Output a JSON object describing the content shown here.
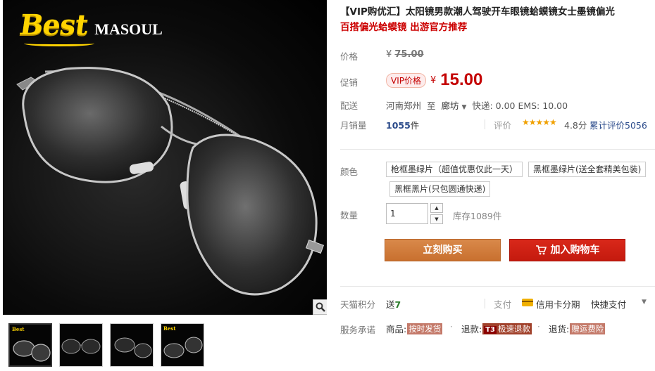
{
  "brand": {
    "best": "Best",
    "masoul": "MASOUL"
  },
  "product": {
    "title": "【VIP购优汇】太阳镜男款潮人驾驶开车眼镜蛤蟆镜女士墨镜偏光",
    "subtitle": "百搭偏光蛤蟆镜 出游官方推荐"
  },
  "price": {
    "label": "价格",
    "currency": "¥",
    "original": "75.00"
  },
  "promo": {
    "label": "促销",
    "tag": "VIP价格",
    "currency": "¥",
    "price": "15.00"
  },
  "shipping": {
    "label": "配送",
    "origin": "河南郑州",
    "to": "至",
    "dest": "廊坊",
    "info": "快递: 0.00 EMS: 10.00"
  },
  "sales": {
    "label": "月销量",
    "count": "1055",
    "unit": "件"
  },
  "rating": {
    "label": "评价",
    "stars": "★★★★★",
    "score": "4.8分",
    "reviews": "累计评价5056",
    "value": 4.8
  },
  "color": {
    "label": "颜色",
    "options": [
      "枪框墨绿片（超值优惠仅此一天）",
      "黑框墨绿片(送全套精美包装)",
      "黑框黑片(只包圆通快递)"
    ]
  },
  "quantity": {
    "label": "数量",
    "value": "1",
    "stock": "库存1089件",
    "up": "▲",
    "down": "▼"
  },
  "buttons": {
    "buy_now": "立刻购买",
    "add_cart": "加入购物车"
  },
  "points": {
    "label": "天猫积分",
    "text": "送",
    "value": "7"
  },
  "payment": {
    "label": "支付",
    "installment": "信用卡分期",
    "quickpay": "快捷支付"
  },
  "service": {
    "label": "服务承诺",
    "goods_label": "商品:",
    "goods_tag": "按时发货",
    "refund_label": "退款:",
    "refund_mark": "T3",
    "refund_tag": "极速退款",
    "return_label": "退货:",
    "return_tag": "赠运费险"
  },
  "colors": {
    "accent_red": "#c40000",
    "buy_orange": "#d07a3a",
    "cart_red": "#d0220f",
    "link_blue": "#2a4a8a"
  }
}
